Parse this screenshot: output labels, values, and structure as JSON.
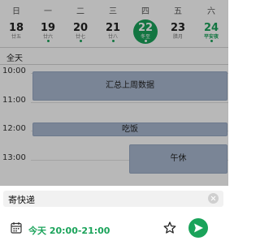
{
  "week": {
    "days": [
      {
        "weekday": "日",
        "date": "18",
        "lunar": "廿五",
        "dot": false
      },
      {
        "weekday": "一",
        "date": "19",
        "lunar": "廿六",
        "dot": true
      },
      {
        "weekday": "二",
        "date": "20",
        "lunar": "廿七",
        "dot": true
      },
      {
        "weekday": "三",
        "date": "21",
        "lunar": "廿八",
        "dot": true
      },
      {
        "weekday": "四",
        "date": "22",
        "lunar": "冬至",
        "dot": true,
        "selected": true
      },
      {
        "weekday": "五",
        "date": "23",
        "lunar": "腊月",
        "dot": false
      },
      {
        "weekday": "六",
        "date": "24",
        "lunar": "平安夜",
        "dot": true,
        "holiday": true
      }
    ]
  },
  "allday_label": "全天",
  "hours": [
    "10:00",
    "11:00",
    "12:00",
    "13:00"
  ],
  "events": [
    {
      "title": "汇总上周数据",
      "start": "10:00",
      "end": "11:00"
    },
    {
      "title": "吃饭",
      "start": "12:00",
      "end": "12:30"
    },
    {
      "title": "午休",
      "start": "12:30",
      "end": "13:30"
    }
  ],
  "composer": {
    "title": "寄快递",
    "date_today": "今天",
    "time_range": "20:00-21:00"
  },
  "colors": {
    "accent": "#1aa35a",
    "event_fill": "#aab9d0"
  }
}
